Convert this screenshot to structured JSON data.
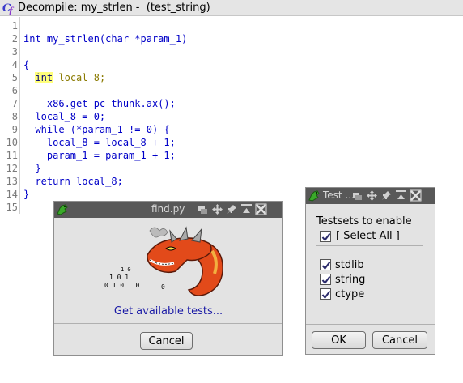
{
  "window": {
    "title": "Decompile: my_strlen -  (test_string)"
  },
  "editor": {
    "line_numbers": [
      "1",
      "2",
      "3",
      "4",
      "5",
      "6",
      "7",
      "8",
      "9",
      "10",
      "11",
      "12",
      "13",
      "14",
      "15"
    ],
    "lines": {
      "l2": "int my_strlen(char *param_1)",
      "l4": "{",
      "l5_type": "int",
      "l5_rest": " local_8;",
      "l7": "  __x86.get_pc_thunk.ax();",
      "l8": "  local_8 = 0;",
      "l9": "  while (*param_1 != 0) {",
      "l10": "    local_8 = local_8 + 1;",
      "l11": "    param_1 = param_1 + 1;",
      "l12": "  }",
      "l13": "  return local_8;",
      "l14": "}"
    }
  },
  "find_dialog": {
    "title": "find.py",
    "status": "Get available tests...",
    "cancel_label": "Cancel"
  },
  "tests_dialog": {
    "title": "Test ...",
    "heading": "Testsets to enable",
    "select_all": "[ Select All ]",
    "items": [
      "stdlib",
      "string",
      "ctype"
    ],
    "ok_label": "OK",
    "cancel_label": "Cancel"
  },
  "colors": {
    "titlebar": "#585858",
    "dialog_bg": "#e3e3e3",
    "code_blue": "#0000c8",
    "link_blue": "#1a1aa6"
  }
}
